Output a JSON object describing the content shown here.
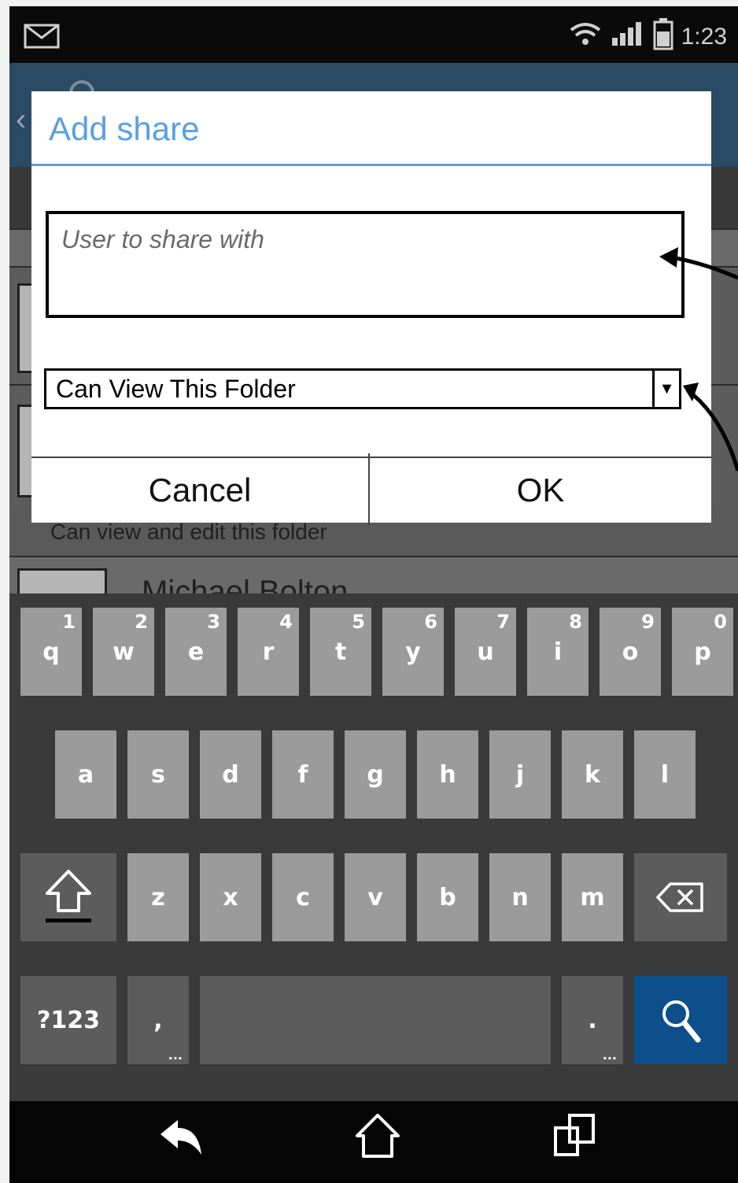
{
  "status_bar": {
    "time": "1:23",
    "icons": [
      "mail-icon",
      "wifi-icon",
      "signal-icon",
      "battery-icon"
    ]
  },
  "background": {
    "caption": "Can view and edit this folder",
    "name": "Michael Bolton"
  },
  "dialog": {
    "title": "Add share",
    "user_input_placeholder": "User to share with",
    "permission_value": "Can View This Folder",
    "cancel_label": "Cancel",
    "ok_label": "OK",
    "colors": {
      "title": "#5aa0e0"
    }
  },
  "keyboard": {
    "row1": [
      {
        "key": "q",
        "num": "1"
      },
      {
        "key": "w",
        "num": "2"
      },
      {
        "key": "e",
        "num": "3"
      },
      {
        "key": "r",
        "num": "4"
      },
      {
        "key": "t",
        "num": "5"
      },
      {
        "key": "y",
        "num": "6"
      },
      {
        "key": "u",
        "num": "7"
      },
      {
        "key": "i",
        "num": "8"
      },
      {
        "key": "o",
        "num": "9"
      },
      {
        "key": "p",
        "num": "0"
      }
    ],
    "row2": [
      "a",
      "s",
      "d",
      "f",
      "g",
      "h",
      "j",
      "k",
      "l"
    ],
    "row3": [
      "z",
      "x",
      "c",
      "v",
      "b",
      "n",
      "m"
    ],
    "symbols_label": "?123",
    "comma_label": ",",
    "period_label": ".",
    "search_color": "#0d4f8b"
  },
  "nav_bar": {
    "icons": [
      "back-icon",
      "home-icon",
      "recents-icon"
    ]
  }
}
